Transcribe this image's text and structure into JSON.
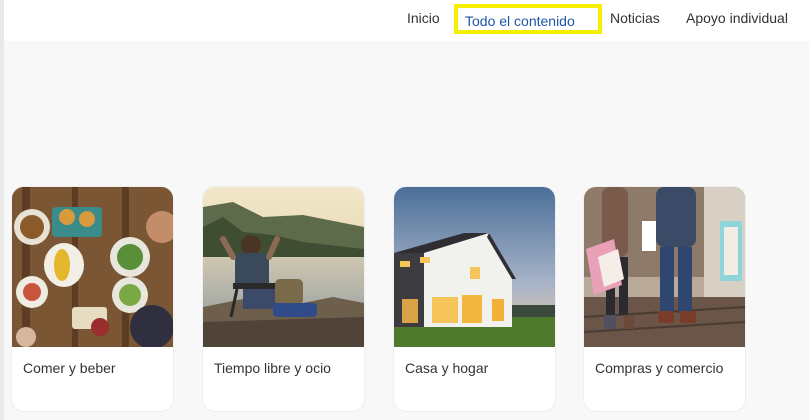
{
  "nav": {
    "items": [
      {
        "label": "Inicio"
      },
      {
        "label": "Todo el contenido",
        "active": true
      },
      {
        "label": "Noticias"
      },
      {
        "label": "Apoyo individual"
      }
    ],
    "active_color": "#1f55a6",
    "highlight_color": "#f7ef00"
  },
  "cards": [
    {
      "label": "Comer y beber",
      "icon": "food-table-photo"
    },
    {
      "label": "Tiempo libre y ocio",
      "icon": "lake-relax-photo"
    },
    {
      "label": "Casa y hogar",
      "icon": "house-photo"
    },
    {
      "label": "Compras y comercio",
      "icon": "shopping-photo"
    }
  ]
}
